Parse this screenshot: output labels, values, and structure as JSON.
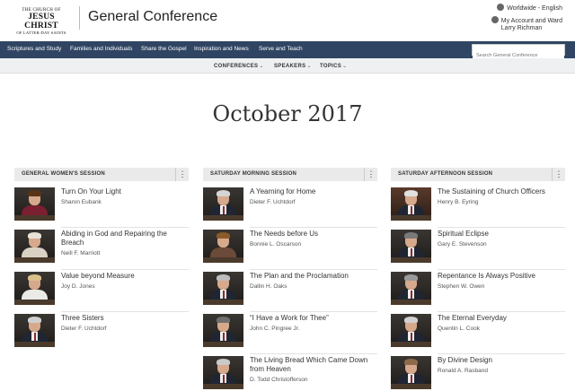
{
  "header": {
    "logo_line1": "THE CHURCH OF",
    "logo_line2": "JESUS CHRIST",
    "logo_line3": "OF LATTER-DAY SAINTS",
    "site_title": "General Conference",
    "language": "Worldwide - English",
    "account": "My Account and Ward",
    "user": "Larry Richman"
  },
  "nav": {
    "items": [
      "Scriptures and Study",
      "Families and Individuals",
      "Share the Gospel",
      "Inspiration and News",
      "Serve and Teach"
    ],
    "search_placeholder": "Search General Conference"
  },
  "subnav": {
    "items": [
      "CONFERENCES",
      "SPEAKERS",
      "TOPICS"
    ]
  },
  "page": {
    "title": "October 2017"
  },
  "sessions": [
    {
      "title": "GENERAL WOMEN'S SESSION",
      "talks": [
        {
          "title": "Turn On Your Light",
          "speaker": "Sharon Eubank"
        },
        {
          "title": "Abiding in God and Repairing the Breach",
          "speaker": "Neill F. Marriott"
        },
        {
          "title": "Value beyond Measure",
          "speaker": "Joy D. Jones"
        },
        {
          "title": "Three Sisters",
          "speaker": "Dieter F. Uchtdorf"
        }
      ]
    },
    {
      "title": "SATURDAY MORNING SESSION",
      "talks": [
        {
          "title": "A Yearning for Home",
          "speaker": "Dieter F. Uchtdorf"
        },
        {
          "title": "The Needs before Us",
          "speaker": "Bonnie L. Oscarson"
        },
        {
          "title": "The Plan and the Proclamation",
          "speaker": "Dallin H. Oaks"
        },
        {
          "title": "“I Have a Work for Thee”",
          "speaker": "John C. Pingree Jr."
        },
        {
          "title": "The Living Bread Which Came Down from Heaven",
          "speaker": "D. Todd Christofferson"
        }
      ]
    },
    {
      "title": "SATURDAY AFTERNOON SESSION",
      "talks": [
        {
          "title": "The Sustaining of Church Officers",
          "speaker": "Henry B. Eyring"
        },
        {
          "title": "Spiritual Eclipse",
          "speaker": "Gary E. Stevenson"
        },
        {
          "title": "Repentance Is Always Positive",
          "speaker": "Stephen W. Owen"
        },
        {
          "title": "The Eternal Everyday",
          "speaker": "Quentin L. Cook"
        },
        {
          "title": "By Divine Design",
          "speaker": "Ronald A. Rasband"
        }
      ]
    }
  ],
  "colors": {
    "nav_bg": "#2f4563",
    "subnav_bg": "#eef0f2",
    "session_header_bg": "#eaeaea"
  },
  "icons": {
    "globe": "globe-icon",
    "account": "account-icon",
    "more": "more-vertical-icon",
    "chevron": "chevron-down-icon"
  }
}
